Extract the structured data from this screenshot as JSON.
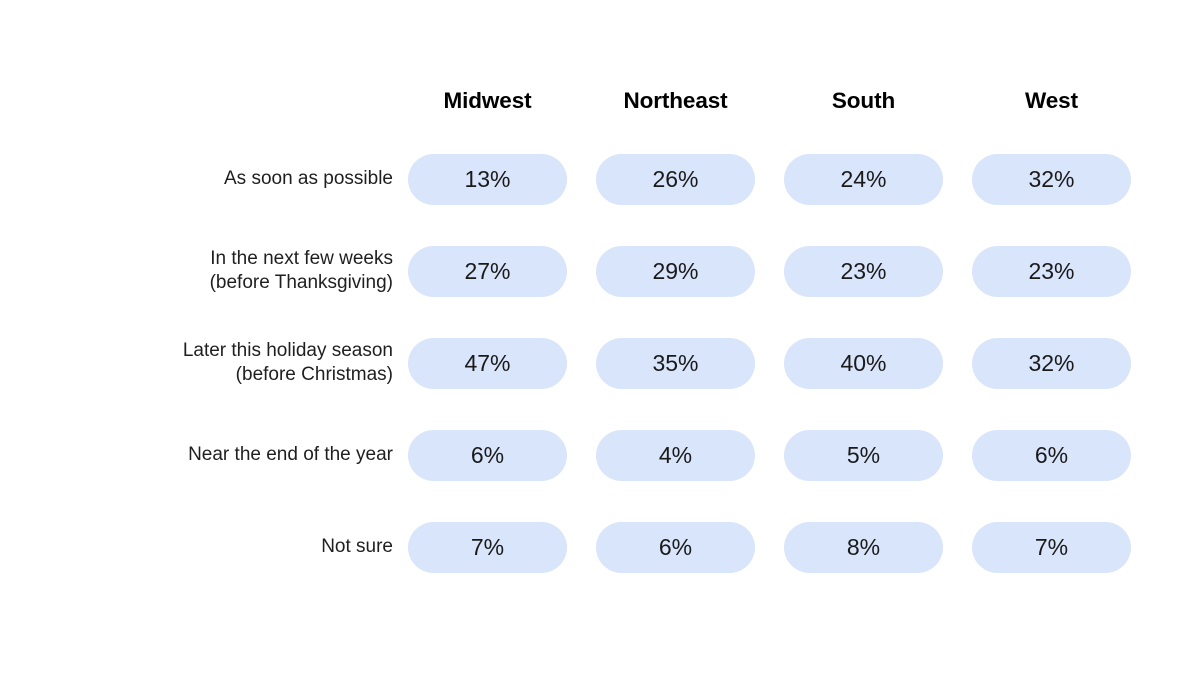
{
  "chart_data": {
    "type": "heatmap",
    "title": "",
    "subtitle": "",
    "xlabel": "",
    "ylabel": "",
    "grid": false,
    "legend": "none",
    "cell_style": "rounded-pill",
    "value_suffix": "%",
    "cell_color": "#d9e5fb",
    "text_color": "#1a1a1a",
    "background": "#ffffff",
    "categories": [
      "Midwest",
      "Northeast",
      "South",
      "West"
    ],
    "rows": [
      "As soon as possible",
      "In the next few weeks (before Thanksgiving)",
      "Later this holiday season (before Christmas)",
      "Near the end of the year",
      "Not sure"
    ],
    "values": [
      [
        13,
        26,
        24,
        32
      ],
      [
        27,
        29,
        23,
        23
      ],
      [
        47,
        35,
        40,
        32
      ],
      [
        6,
        4,
        5,
        6
      ],
      [
        7,
        6,
        8,
        7
      ]
    ]
  },
  "header": {
    "columns": [
      {
        "label": "Midwest"
      },
      {
        "label": "Northeast"
      },
      {
        "label": "South"
      },
      {
        "label": "West"
      }
    ]
  },
  "rows": [
    {
      "label_line1": "As soon as possible",
      "label_line2": "",
      "cells": [
        {
          "value": "13%"
        },
        {
          "value": "26%"
        },
        {
          "value": "24%"
        },
        {
          "value": "32%"
        }
      ]
    },
    {
      "label_line1": "In the next few weeks",
      "label_line2": "(before Thanksgiving)",
      "cells": [
        {
          "value": "27%"
        },
        {
          "value": "29%"
        },
        {
          "value": "23%"
        },
        {
          "value": "23%"
        }
      ]
    },
    {
      "label_line1": "Later this holiday season",
      "label_line2": "(before Christmas)",
      "cells": [
        {
          "value": "47%"
        },
        {
          "value": "35%"
        },
        {
          "value": "40%"
        },
        {
          "value": "32%"
        }
      ]
    },
    {
      "label_line1": "Near the end of the year",
      "label_line2": "",
      "cells": [
        {
          "value": "6%"
        },
        {
          "value": "4%"
        },
        {
          "value": "5%"
        },
        {
          "value": "6%"
        }
      ]
    },
    {
      "label_line1": "Not sure",
      "label_line2": "",
      "cells": [
        {
          "value": "7%"
        },
        {
          "value": "6%"
        },
        {
          "value": "8%"
        },
        {
          "value": "7%"
        }
      ]
    }
  ]
}
